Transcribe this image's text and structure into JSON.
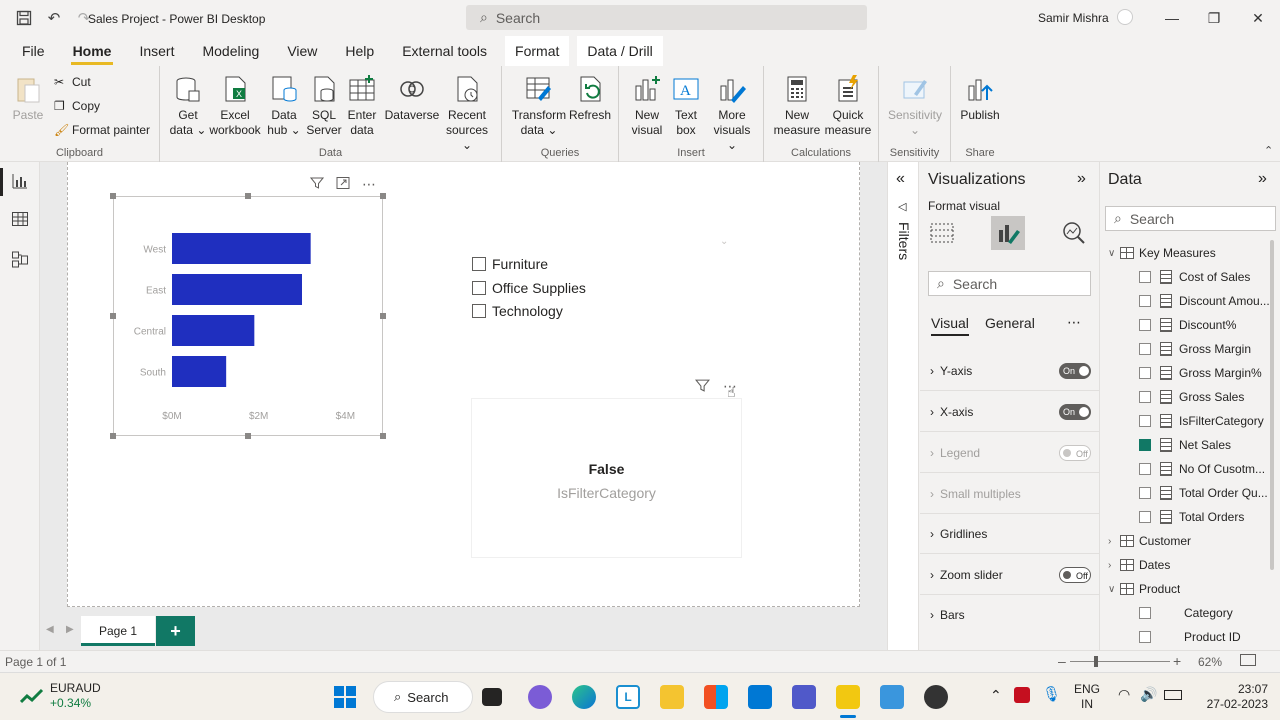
{
  "titlebar": {
    "app_title": "Sales Project - Power BI Desktop",
    "search_placeholder": "Search",
    "user_name": "Samir Mishra"
  },
  "menu": {
    "tabs": [
      "File",
      "Home",
      "Insert",
      "Modeling",
      "View",
      "Help",
      "External tools",
      "Format",
      "Data / Drill"
    ],
    "active": "Home"
  },
  "ribbon": {
    "clipboard": {
      "paste": "Paste",
      "cut": "Cut",
      "copy": "Copy",
      "format_painter": "Format painter",
      "label": "Clipboard"
    },
    "data": {
      "get_data": "Get data",
      "excel": "Excel workbook",
      "data_hub": "Data hub",
      "sql": "SQL Server",
      "enter_data": "Enter data",
      "dataverse": "Dataverse",
      "recent": "Recent sources",
      "label": "Data"
    },
    "queries": {
      "transform": "Transform data",
      "refresh": "Refresh",
      "label": "Queries"
    },
    "insert": {
      "new_visual": "New visual",
      "text_box": "Text box",
      "more_visuals": "More visuals",
      "label": "Insert"
    },
    "calculations": {
      "new_measure": "New measure",
      "quick_measure": "Quick measure",
      "label": "Calculations"
    },
    "sensitivity": {
      "sensitivity": "Sensitivity",
      "label": "Sensitivity"
    },
    "share": {
      "publish": "Publish",
      "label": "Share"
    }
  },
  "chart_data": {
    "type": "bar",
    "orientation": "horizontal",
    "categories": [
      "West",
      "East",
      "Central",
      "South"
    ],
    "values": [
      3.2,
      3.0,
      1.9,
      1.25
    ],
    "xticks": [
      "$0M",
      "$2M",
      "$4M"
    ],
    "xlim": [
      0,
      4.2
    ],
    "bar_color": "#1f2fbf",
    "title": "",
    "xlabel": "",
    "ylabel": ""
  },
  "slicer": {
    "items": [
      "Furniture",
      "Office Supplies",
      "Technology"
    ]
  },
  "card": {
    "value": "False",
    "label": "IsFilterCategory"
  },
  "filters": {
    "label": "Filters"
  },
  "visualizations": {
    "title": "Visualizations",
    "subtitle": "Format visual",
    "search_placeholder": "Search",
    "tabs": [
      "Visual",
      "General"
    ],
    "cards": [
      {
        "label": "Y-axis",
        "toggle": "On",
        "state": "on"
      },
      {
        "label": "X-axis",
        "toggle": "On",
        "state": "on"
      },
      {
        "label": "Legend",
        "toggle": "Off",
        "state": "off-dim"
      },
      {
        "label": "Small multiples",
        "toggle": "",
        "state": "dim"
      },
      {
        "label": "Gridlines",
        "toggle": "",
        "state": "none"
      },
      {
        "label": "Zoom slider",
        "toggle": "Off",
        "state": "off"
      },
      {
        "label": "Bars",
        "toggle": "",
        "state": "none"
      }
    ]
  },
  "data_pane": {
    "title": "Data",
    "search_placeholder": "Search",
    "tree": [
      {
        "label": "Key Measures",
        "kind": "table-expanded",
        "level": 0
      },
      {
        "label": "Cost of Sales",
        "kind": "measure",
        "level": 1,
        "checked": false
      },
      {
        "label": "Discount Amou...",
        "kind": "measure",
        "level": 1,
        "checked": false
      },
      {
        "label": "Discount%",
        "kind": "measure",
        "level": 1,
        "checked": false
      },
      {
        "label": "Gross Margin",
        "kind": "measure",
        "level": 1,
        "checked": false
      },
      {
        "label": "Gross Margin%",
        "kind": "measure",
        "level": 1,
        "checked": false
      },
      {
        "label": "Gross Sales",
        "kind": "measure",
        "level": 1,
        "checked": false
      },
      {
        "label": "IsFilterCategory",
        "kind": "measure",
        "level": 1,
        "checked": false
      },
      {
        "label": "Net Sales",
        "kind": "measure",
        "level": 1,
        "checked": true
      },
      {
        "label": "No Of Cusotm...",
        "kind": "measure",
        "level": 1,
        "checked": false
      },
      {
        "label": "Total Order Qu...",
        "kind": "measure",
        "level": 1,
        "checked": false
      },
      {
        "label": "Total Orders",
        "kind": "measure",
        "level": 1,
        "checked": false
      },
      {
        "label": "Customer",
        "kind": "table-collapsed",
        "level": 0
      },
      {
        "label": "Dates",
        "kind": "table-collapsed",
        "level": 0
      },
      {
        "label": "Product",
        "kind": "table-expanded",
        "level": 0
      },
      {
        "label": "Category",
        "kind": "field",
        "level": 1,
        "checked": false
      },
      {
        "label": "Product ID",
        "kind": "field",
        "level": 1,
        "checked": false
      }
    ]
  },
  "pages": {
    "tab": "Page 1",
    "add": "+"
  },
  "status": {
    "page_info": "Page 1 of 1",
    "zoom": "62%"
  },
  "taskbar": {
    "stock_name": "EURAUD",
    "stock_change": "+0.34%",
    "search": "Search",
    "lang1": "ENG",
    "lang2": "IN",
    "time": "23:07",
    "date": "27-02-2023"
  }
}
